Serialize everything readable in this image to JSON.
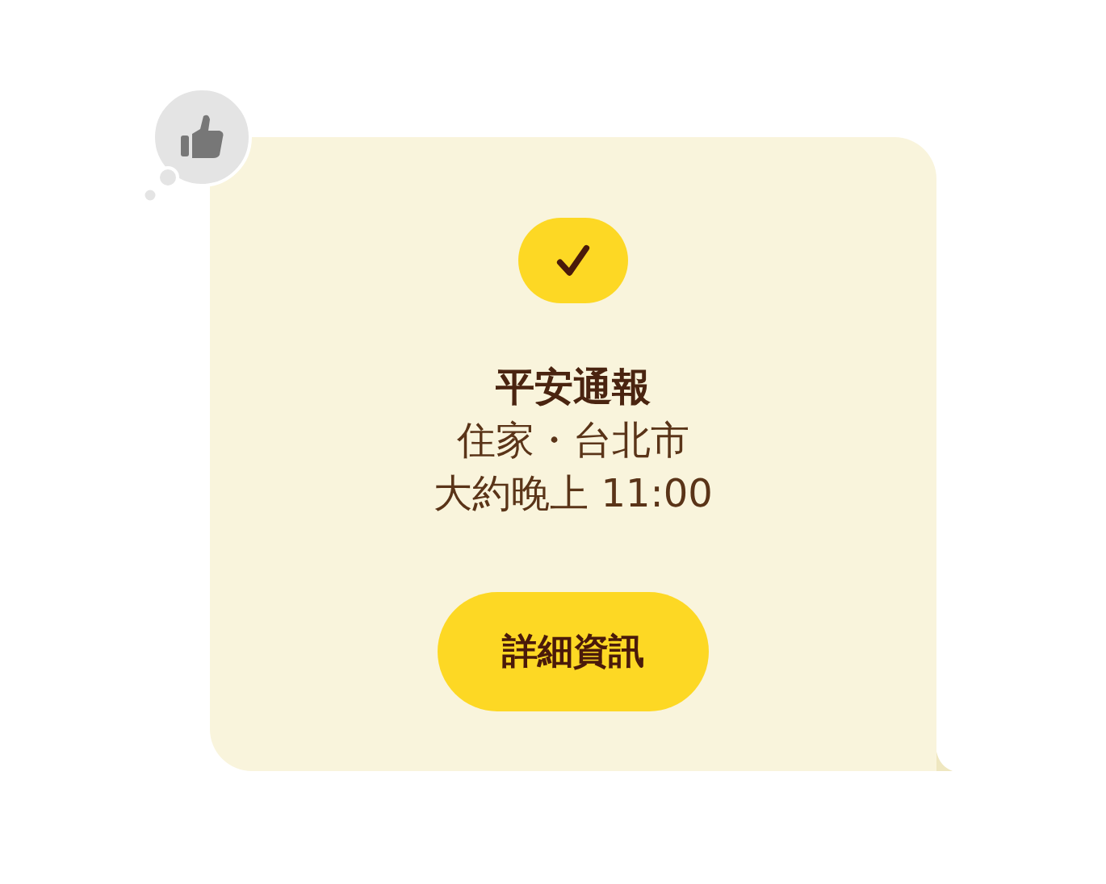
{
  "message": {
    "reaction": {
      "kind": "thumbs-up"
    },
    "status": {
      "kind": "check"
    },
    "title": "平安通報",
    "lines": [
      "住家・台北市",
      "大約晚上 11:00"
    ],
    "button": {
      "label": "詳細資訊"
    }
  }
}
